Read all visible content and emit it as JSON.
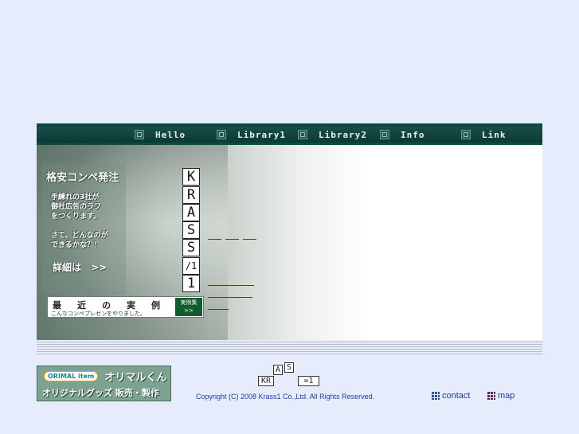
{
  "nav": {
    "items": [
      {
        "label": "Hello"
      },
      {
        "label": "Library1"
      },
      {
        "label": "Library2"
      },
      {
        "label": "Info"
      },
      {
        "label": "Link"
      }
    ]
  },
  "promo": {
    "title": "格安コンペ発注",
    "line1": "手練れの3社が",
    "line2": "御社広告のラフ",
    "line3": "をつくります。",
    "line4": "さて、どんなのが",
    "line5": "できるかな？！",
    "detail": "詳細は　>>"
  },
  "banner": {
    "chars": [
      "最",
      "近",
      "の",
      "実",
      "例"
    ],
    "subtitle": "こんなコンペプレゼンをやりました。",
    "button_line1": "実例集",
    "button_line2": ">>"
  },
  "logo_tiles": [
    "K",
    "R",
    "A",
    "S",
    "S",
    "/1",
    "1"
  ],
  "footer": {
    "orimaru_logo": "ORIMAL item",
    "orimaru_name": "オリマルくん",
    "orimaru_tagline": "オリジナルグッズ 販売・製作",
    "small_logo": {
      "top1": "A",
      "top2": "S",
      "bottom1": "KR",
      "bottom2": "=1"
    },
    "copyright": "Copyright (C) 2008 Krass1 Co.,Ltd. All Rights Reserved.",
    "contact_label": "contact",
    "map_label": "map",
    "contact_icon": "grid-icon",
    "map_icon": "grid-icon"
  },
  "colors": {
    "page_bg": "#e6ecfc",
    "nav_bg": "#0d4a44",
    "link": "#1d3fbf",
    "footer_text": "#1e3e9a"
  }
}
